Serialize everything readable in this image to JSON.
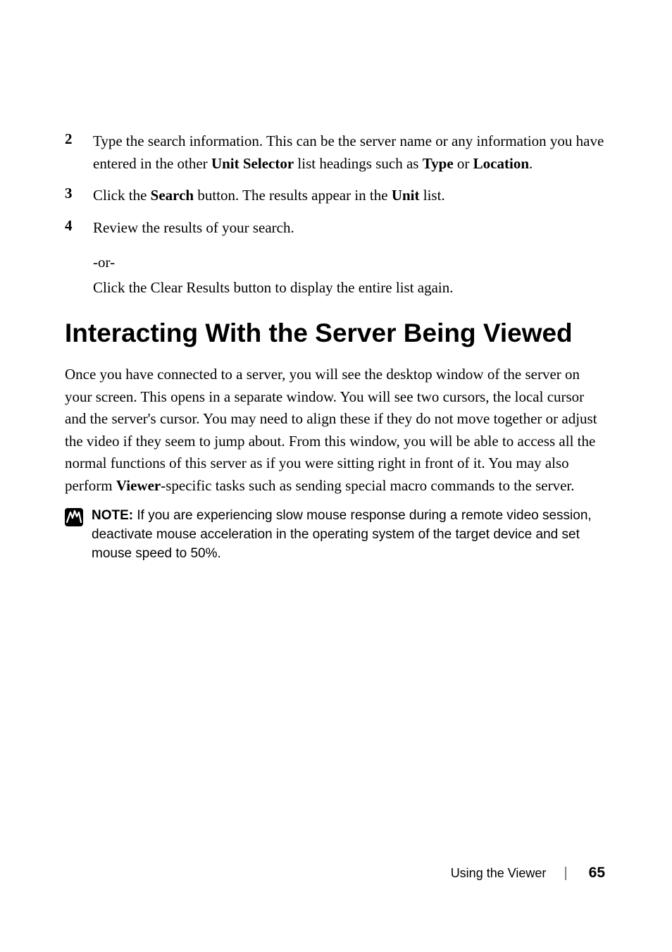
{
  "steps": {
    "item2": {
      "num": "2",
      "text_before": "Type the search information. This can be the server name or any information you have entered in the other ",
      "bold1": "Unit Selector",
      "text_mid": " list headings such as ",
      "bold2": "Type",
      "text_mid2": " or ",
      "bold3": "Location",
      "text_after": "."
    },
    "item3": {
      "num": "3",
      "text_before": "Click the ",
      "bold1": "Search",
      "text_mid": " button. The results appear in the ",
      "bold2": "Unit",
      "text_after": " list."
    },
    "item4": {
      "num": "4",
      "text": "Review the results of your search.",
      "or_text": "-or-",
      "sub_before": "Click the ",
      "sub_bold": "Clear Results",
      "sub_after": " button to display the entire list again."
    }
  },
  "heading": "Interacting With the Server Being Viewed",
  "body": {
    "text_before": "Once you have connected to a server, you will see the desktop window of the server on your screen. This opens in a separate window. You will see two cursors, the local cursor and the server's cursor. You may need to align these if they do not move together or adjust the video if they seem to jump about. From this window, you will be able to access all the normal functions of this server as if you were sitting right in front of it. You may also perform ",
    "bold1": "Viewer",
    "text_after": "-specific tasks such as sending special macro commands to the server."
  },
  "note": {
    "label": "NOTE: ",
    "text": "If you are experiencing slow mouse response during a remote video session, deactivate mouse acceleration in the operating system of the target device and set mouse speed to 50%."
  },
  "footer": {
    "title": "Using the Viewer",
    "page": "65"
  }
}
